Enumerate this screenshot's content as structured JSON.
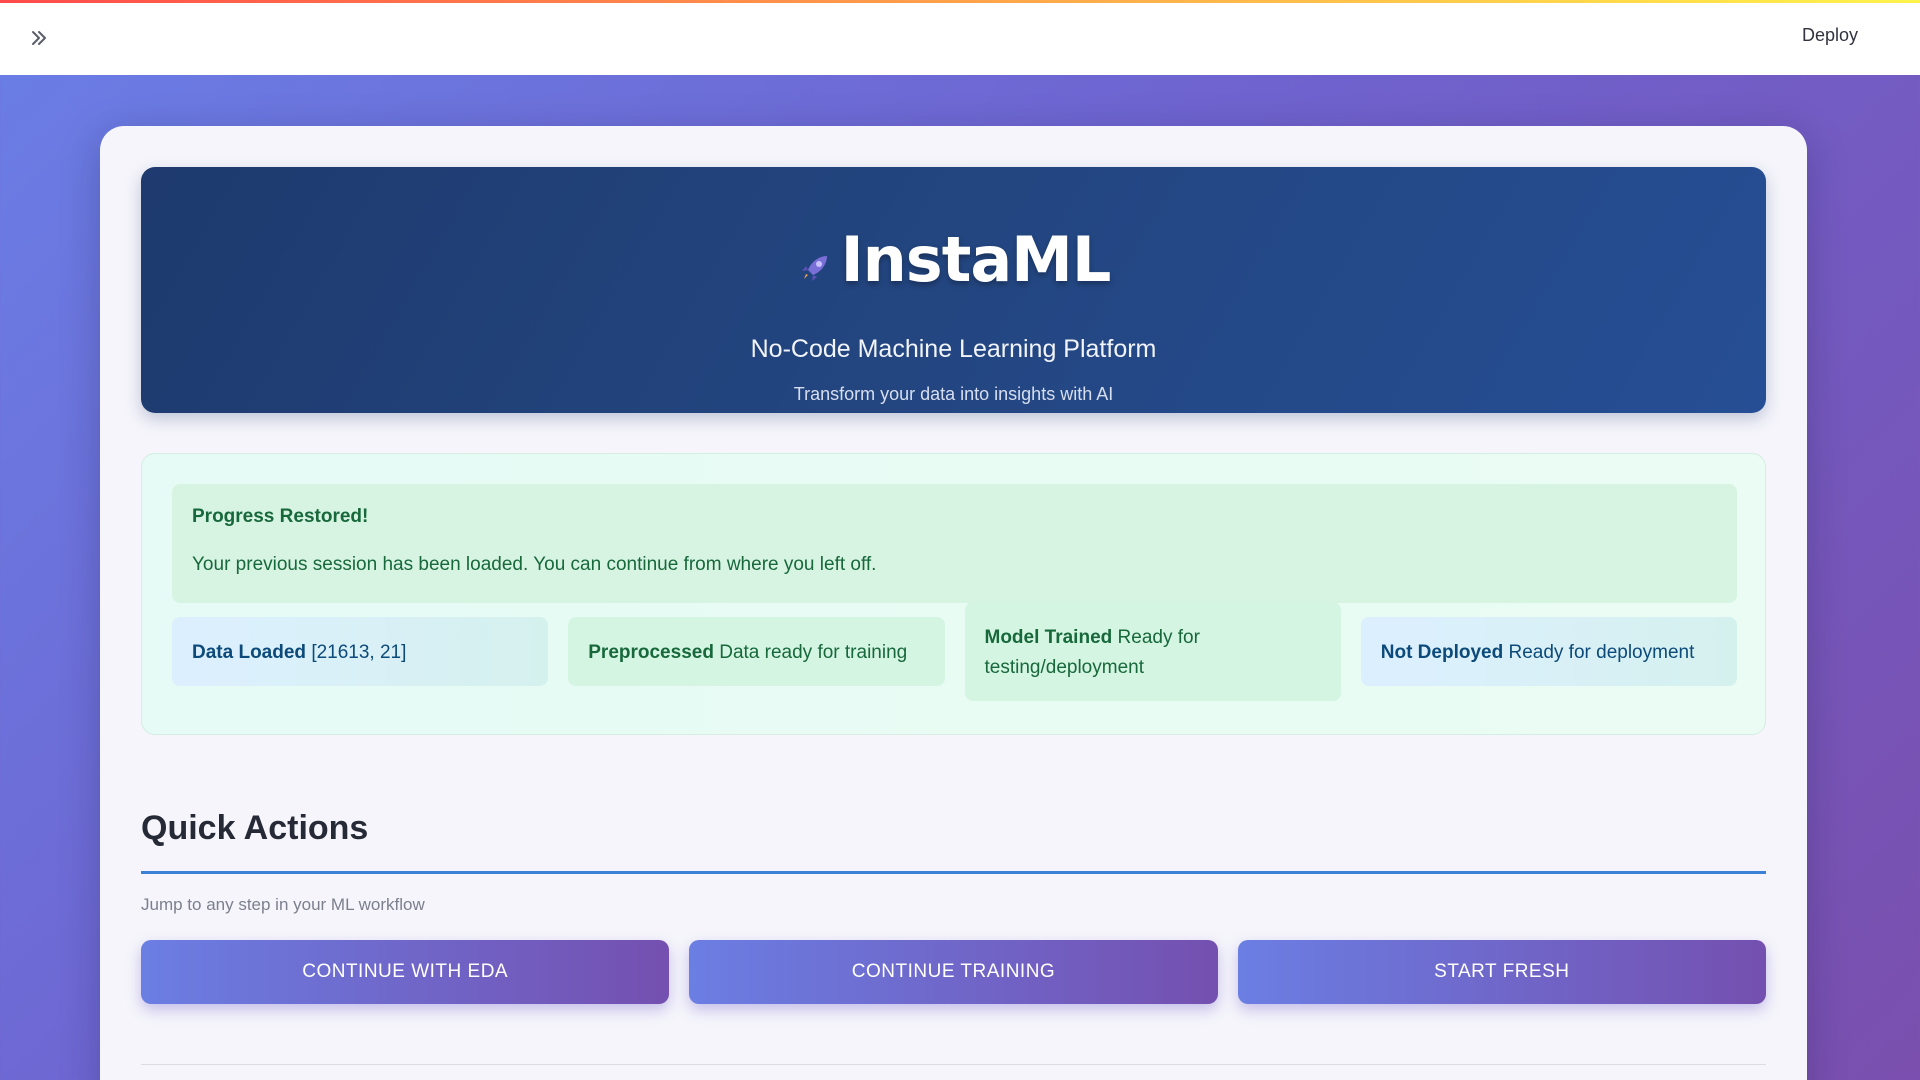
{
  "topbar": {
    "deploy_label": "Deploy"
  },
  "hero": {
    "title": "InstaML",
    "subtitle": "No-Code Machine Learning Platform",
    "tagline": "Transform your data into insights with AI"
  },
  "alert": {
    "title": "Progress Restored!",
    "body": "Your previous session has been loaded. You can continue from where you left off."
  },
  "status": [
    {
      "label": "Data Loaded",
      "detail": "[21613, 21]"
    },
    {
      "label": "Preprocessed",
      "detail": "Data ready for training"
    },
    {
      "label": "Model Trained",
      "detail": "Ready for testing/deployment"
    },
    {
      "label": "Not Deployed",
      "detail": "Ready for deployment"
    }
  ],
  "quick_actions": {
    "title": "Quick Actions",
    "hint": "Jump to any step in your ML workflow",
    "buttons": [
      "CONTINUE WITH EDA",
      "CONTINUE TRAINING",
      "START FRESH"
    ]
  },
  "icons": {
    "sidebar_toggle": "double-chevron-right-icon",
    "logo": "rocket-icon"
  },
  "colors": {
    "hero_bg": "#234681",
    "success_text": "#17683b",
    "info_text": "#0b4a7a",
    "accent_rule": "#3b82d6",
    "button_start": "#6b7ee3",
    "button_end": "#7450b0"
  }
}
